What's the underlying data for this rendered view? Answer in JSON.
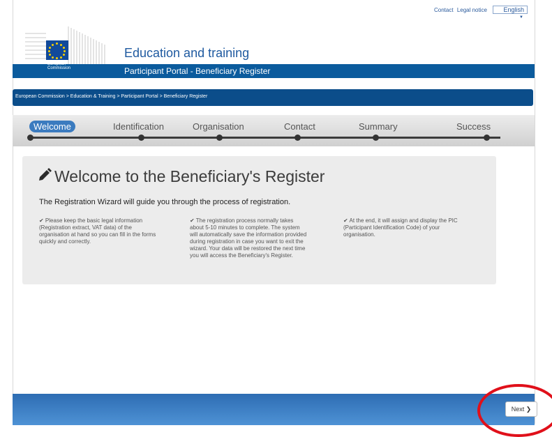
{
  "header": {
    "links": [
      "Contact",
      "Legal notice"
    ],
    "language": "English",
    "logo_text": [
      "European",
      "Commission"
    ],
    "site_title": "Education and training",
    "portal_title": "Participant Portal - Beneficiary Register"
  },
  "breadcrumb": "European Commission > Education & Training > Participant Portal > Beneficiary Register",
  "wizard": {
    "steps": [
      "Welcome",
      "Identification",
      "Organisation",
      "Contact",
      "Summary",
      "Success"
    ],
    "active_step": "Welcome"
  },
  "welcome": {
    "title": "Welcome to the Beneficiary's Register",
    "intro": "The Registration Wizard will guide you through the process of registration.",
    "columns": [
      [
        "✔ Please keep the basic legal information",
        "(Registration extract, VAT data) of the",
        "organisation at hand so you can fill in the forms",
        "quickly and correctly."
      ],
      [
        "✔ The registration process normally takes",
        "about 5-10 minutes to complete. The system",
        "will automatically save the information provided",
        "during registration in case you want to exit the",
        "wizard. Your data will be restored the next time",
        "you will access the Beneficiary's Register."
      ],
      [
        "✔ At the end, it will assign and display the PIC",
        "(Participant Identification Code) of your",
        "organisation."
      ]
    ]
  },
  "footer": {
    "next_label": "Next ❯"
  },
  "colors": {
    "brand_blue": "#0b5b9d",
    "active_step": "#3b7bbf",
    "highlight": "#e0101a"
  }
}
